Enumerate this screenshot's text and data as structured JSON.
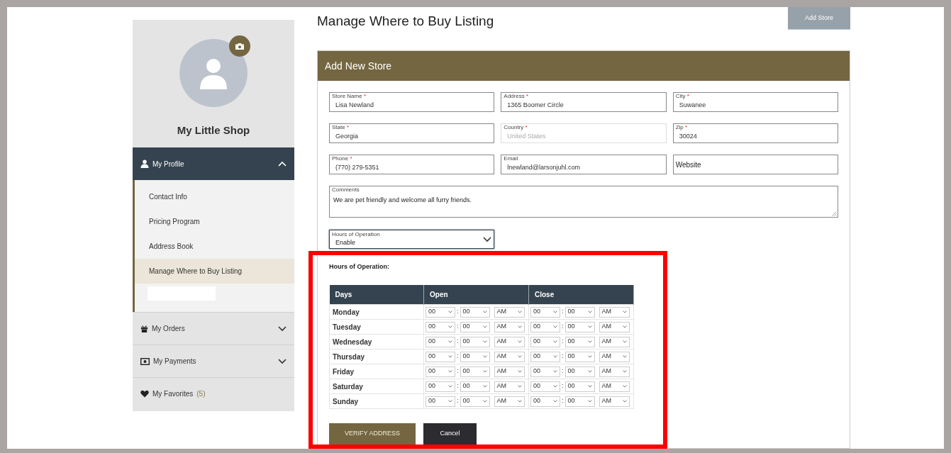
{
  "page_title": "Manage Where to Buy Listing",
  "add_store_button": "Add Store",
  "sidebar": {
    "shop_name": "My Little Shop",
    "sections": [
      {
        "label": "My Profile",
        "expanded": true,
        "items": [
          {
            "label": "Contact Info",
            "selected": false
          },
          {
            "label": "Pricing Program",
            "selected": false
          },
          {
            "label": "Address Book",
            "selected": false
          },
          {
            "label": "Manage Where to Buy Listing",
            "selected": true
          }
        ]
      },
      {
        "label": "My Orders",
        "expanded": false
      },
      {
        "label": "My Payments",
        "expanded": false
      },
      {
        "label": "My Favorites",
        "count": "(5)"
      }
    ]
  },
  "form": {
    "title": "Add New Store",
    "fields": [
      {
        "label": "Store Name",
        "required_mark": "*",
        "value": "Lisa Newland",
        "disabled": false
      },
      {
        "label": "Address",
        "required_mark": "*",
        "value": "1365 Boomer Circle",
        "disabled": false
      },
      {
        "label": "City",
        "required_mark": "*",
        "value": "Suwanee",
        "disabled": false
      },
      {
        "label": "State",
        "required_mark": "*",
        "value": "Georgia",
        "disabled": false
      },
      {
        "label": "Country",
        "required_mark": "*",
        "value": "United States",
        "disabled": true
      },
      {
        "label": "Zip",
        "required_mark": "*",
        "value": "30024",
        "disabled": false
      },
      {
        "label": "Phone",
        "required_mark": "*",
        "value": "(770) 279-5351",
        "disabled": false
      },
      {
        "label": "Email",
        "value": "lnewland@larsonjuhl.com",
        "disabled": false
      },
      {
        "placeholder": "Website",
        "disabled": false
      }
    ],
    "comments": {
      "label": "Comments",
      "value": "We are pet friendly and welcome all furry friends."
    },
    "hours_select": {
      "label": "Hours of Operation",
      "value": "Enable"
    },
    "hours": {
      "heading": "Hours of Operation:",
      "columns": [
        "Days",
        "Open",
        "Close"
      ],
      "time_separator": ":",
      "rows": [
        {
          "day": "Monday",
          "open": [
            "00",
            "00",
            "AM"
          ],
          "close": [
            "00",
            "00",
            "AM"
          ]
        },
        {
          "day": "Tuesday",
          "open": [
            "00",
            "00",
            "AM"
          ],
          "close": [
            "00",
            "00",
            "AM"
          ]
        },
        {
          "day": "Wednesday",
          "open": [
            "00",
            "00",
            "AM"
          ],
          "close": [
            "00",
            "00",
            "AM"
          ]
        },
        {
          "day": "Thursday",
          "open": [
            "00",
            "00",
            "AM"
          ],
          "close": [
            "00",
            "00",
            "AM"
          ]
        },
        {
          "day": "Friday",
          "open": [
            "00",
            "00",
            "AM"
          ],
          "close": [
            "00",
            "00",
            "AM"
          ]
        },
        {
          "day": "Saturday",
          "open": [
            "00",
            "00",
            "AM"
          ],
          "close": [
            "00",
            "00",
            "AM"
          ]
        },
        {
          "day": "Sunday",
          "open": [
            "00",
            "00",
            "AM"
          ],
          "close": [
            "00",
            "00",
            "AM"
          ]
        }
      ]
    },
    "buttons": [
      {
        "label": "VERIFY ADDRESS",
        "kind": "primary"
      },
      {
        "label": "Cancel",
        "kind": "secondary"
      }
    ]
  }
}
